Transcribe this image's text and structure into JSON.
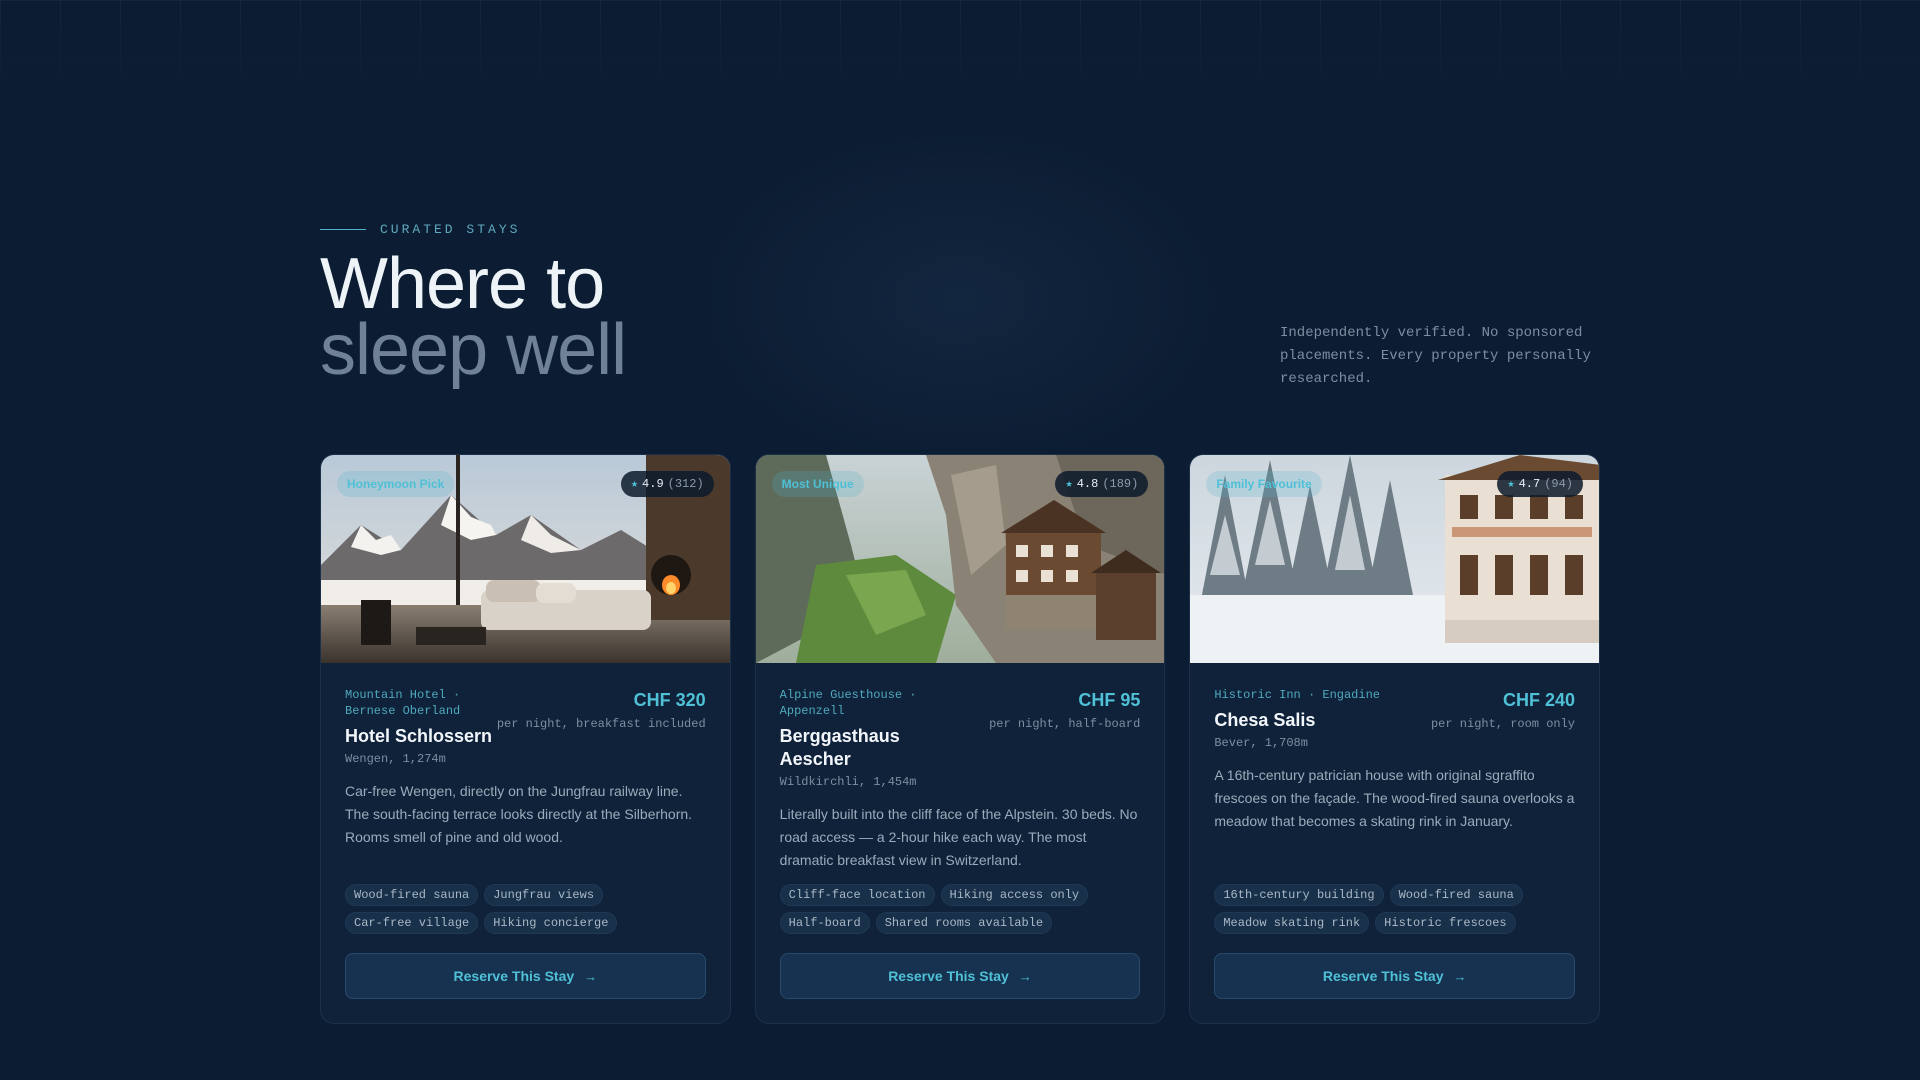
{
  "header": {
    "eyebrow": "CURATED STAYS",
    "title_line1": "Where to",
    "title_line2": "sleep well",
    "blurb": "Independently verified. No sponsored placements. Every property personally researched."
  },
  "colors": {
    "background": "#0c1d33",
    "card": "#0f223a",
    "accent": "#4fc0d6",
    "muted": "#7d8ea0"
  },
  "cards": [
    {
      "badge": "Honeymoon Pick",
      "rating": "4.9",
      "reviews": "(312)",
      "kicker": "Mountain Hotel · Bernese Oberland",
      "name": "Hotel Schlossern",
      "location": "Wengen, 1,274m",
      "price": "CHF 320",
      "price_note": "per night, breakfast included",
      "description": "Car-free Wengen, directly on the Jungfrau railway line. The south-facing terrace looks directly at the Silberhorn. Rooms smell of pine and old wood.",
      "tags": [
        "Wood-fired sauna",
        "Jungfrau views",
        "Car-free village",
        "Hiking concierge"
      ],
      "button": "Reserve This Stay",
      "image": "alpine-lounge-with-fireplace"
    },
    {
      "badge": "Most Unique",
      "rating": "4.8",
      "reviews": "(189)",
      "kicker": "Alpine Guesthouse · Appenzell",
      "name": "Berggasthaus Aescher",
      "location": "Wildkirchli, 1,454m",
      "price": "CHF 95",
      "price_note": "per night, half-board",
      "description": "Literally built into the cliff face of the Alpstein. 30 beds. No road access — a 2-hour hike each way. The most dramatic breakfast view in Switzerland.",
      "tags": [
        "Cliff-face location",
        "Hiking access only",
        "Half-board",
        "Shared rooms available"
      ],
      "button": "Reserve This Stay",
      "image": "cliffside-guesthouse"
    },
    {
      "badge": "Family Favourite",
      "rating": "4.7",
      "reviews": "(94)",
      "kicker": "Historic Inn · Engadine",
      "name": "Chesa Salis",
      "location": "Bever, 1,708m",
      "price": "CHF 240",
      "price_note": "per night, room only",
      "description": "A 16th-century patrician house with original sgraffito frescoes on the façade. The wood-fired sauna overlooks a meadow that becomes a skating rink in January.",
      "tags": [
        "16th-century building",
        "Wood-fired sauna",
        "Meadow skating rink",
        "Historic frescoes"
      ],
      "button": "Reserve This Stay",
      "image": "snowy-forest-inn"
    }
  ]
}
